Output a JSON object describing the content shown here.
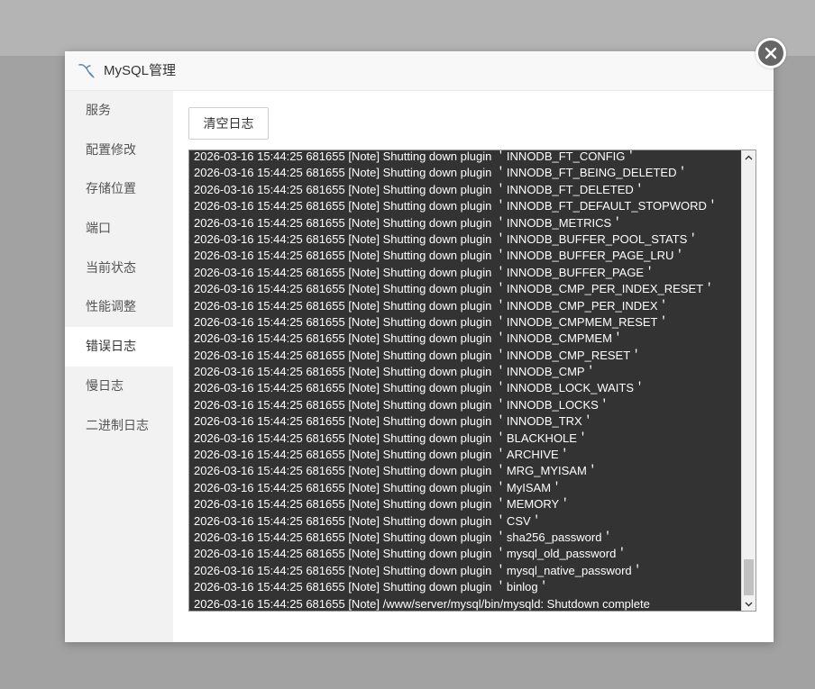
{
  "dialog": {
    "title": "MySQL管理",
    "icon": "mysql-dolphin-icon",
    "close_icon": "close-icon"
  },
  "sidebar": {
    "items": [
      {
        "label": "服务"
      },
      {
        "label": "配置修改"
      },
      {
        "label": "存储位置"
      },
      {
        "label": "端口"
      },
      {
        "label": "当前状态"
      },
      {
        "label": "性能调整"
      },
      {
        "label": "错误日志",
        "active": true
      },
      {
        "label": "慢日志"
      },
      {
        "label": "二进制日志"
      }
    ]
  },
  "content": {
    "clear_button_label": "清空日志",
    "log_lines": [
      "2026-03-16 15:44:25 681655 [Note] Shutting down plugin ＇INNODB_FT_CONFIG＇",
      "2026-03-16 15:44:25 681655 [Note] Shutting down plugin ＇INNODB_FT_BEING_DELETED＇",
      "2026-03-16 15:44:25 681655 [Note] Shutting down plugin ＇INNODB_FT_DELETED＇",
      "2026-03-16 15:44:25 681655 [Note] Shutting down plugin ＇INNODB_FT_DEFAULT_STOPWORD＇",
      "2026-03-16 15:44:25 681655 [Note] Shutting down plugin ＇INNODB_METRICS＇",
      "2026-03-16 15:44:25 681655 [Note] Shutting down plugin ＇INNODB_BUFFER_POOL_STATS＇",
      "2026-03-16 15:44:25 681655 [Note] Shutting down plugin ＇INNODB_BUFFER_PAGE_LRU＇",
      "2026-03-16 15:44:25 681655 [Note] Shutting down plugin ＇INNODB_BUFFER_PAGE＇",
      "2026-03-16 15:44:25 681655 [Note] Shutting down plugin ＇INNODB_CMP_PER_INDEX_RESET＇",
      "2026-03-16 15:44:25 681655 [Note] Shutting down plugin ＇INNODB_CMP_PER_INDEX＇",
      "2026-03-16 15:44:25 681655 [Note] Shutting down plugin ＇INNODB_CMPMEM_RESET＇",
      "2026-03-16 15:44:25 681655 [Note] Shutting down plugin ＇INNODB_CMPMEM＇",
      "2026-03-16 15:44:25 681655 [Note] Shutting down plugin ＇INNODB_CMP_RESET＇",
      "2026-03-16 15:44:25 681655 [Note] Shutting down plugin ＇INNODB_CMP＇",
      "2026-03-16 15:44:25 681655 [Note] Shutting down plugin ＇INNODB_LOCK_WAITS＇",
      "2026-03-16 15:44:25 681655 [Note] Shutting down plugin ＇INNODB_LOCKS＇",
      "2026-03-16 15:44:25 681655 [Note] Shutting down plugin ＇INNODB_TRX＇",
      "2026-03-16 15:44:25 681655 [Note] Shutting down plugin ＇BLACKHOLE＇",
      "2026-03-16 15:44:25 681655 [Note] Shutting down plugin ＇ARCHIVE＇",
      "2026-03-16 15:44:25 681655 [Note] Shutting down plugin ＇MRG_MYISAM＇",
      "2026-03-16 15:44:25 681655 [Note] Shutting down plugin ＇MyISAM＇",
      "2026-03-16 15:44:25 681655 [Note] Shutting down plugin ＇MEMORY＇",
      "2026-03-16 15:44:25 681655 [Note] Shutting down plugin ＇CSV＇",
      "2026-03-16 15:44:25 681655 [Note] Shutting down plugin ＇sha256_password＇",
      "2026-03-16 15:44:25 681655 [Note] Shutting down plugin ＇mysql_old_password＇",
      "2026-03-16 15:44:25 681655 [Note] Shutting down plugin ＇mysql_native_password＇",
      "2026-03-16 15:44:25 681655 [Note] Shutting down plugin ＇binlog＇",
      "2026-03-16 15:44:25 681655 [Note] /www/server/mysql/bin/mysqld: Shutdown complete"
    ],
    "scroll_position": 1.0
  }
}
